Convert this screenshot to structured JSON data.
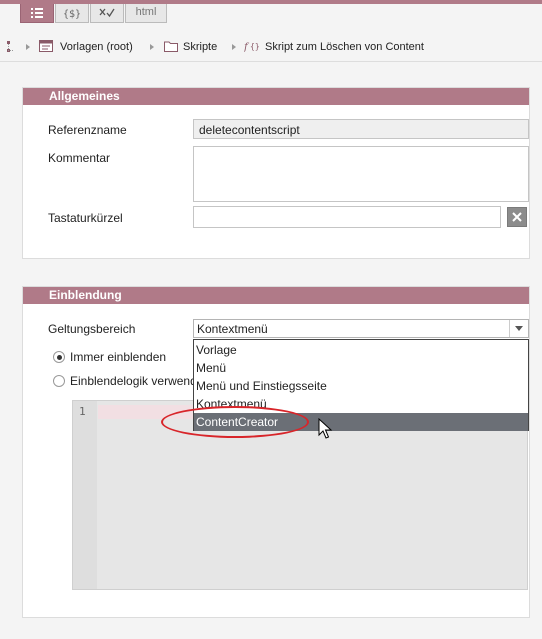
{
  "tabs": [
    {
      "name": "form-view",
      "active": true
    },
    {
      "name": "variables-view"
    },
    {
      "name": "validate-view"
    },
    {
      "name": "html-view",
      "label": "html"
    }
  ],
  "breadcrumb": {
    "items": [
      "Vorlagen (root)",
      "Skripte",
      "Skript zum Löschen von Content"
    ]
  },
  "general": {
    "title": "Allgemeines",
    "ref_label": "Referenzname",
    "ref_value": "deletecontentscript",
    "comment_label": "Kommentar",
    "comment_value": "",
    "shortcut_label": "Tastaturkürzel",
    "shortcut_value": ""
  },
  "display": {
    "title": "Einblendung",
    "scope_label": "Geltungsbereich",
    "scope_value": "Kontextmenü",
    "radio_always": "Immer einblenden",
    "radio_logic": "Einblendelogik verwenden",
    "radio_always_checked": true,
    "editor_line": "1"
  },
  "dropdown": {
    "options": [
      "Vorlage",
      "Menü",
      "Menü und Einstiegsseite",
      "Kontextmenü",
      "ContentCreator"
    ],
    "highlighted": "ContentCreator"
  },
  "colors": {
    "accent": "#b07a88",
    "annotation": "#d8252a"
  }
}
